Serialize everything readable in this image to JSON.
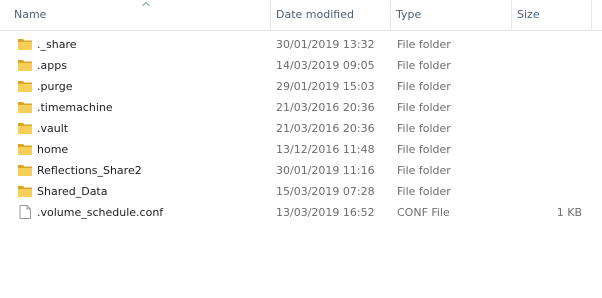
{
  "columns": {
    "name": "Name",
    "date_modified": "Date modified",
    "type": "Type",
    "size": "Size"
  },
  "sort": {
    "column": "name",
    "direction": "ascending"
  },
  "files": [
    {
      "name": "._share",
      "date": "30/01/2019 13:32",
      "type": "File folder",
      "size": "",
      "icon": "folder-icon"
    },
    {
      "name": ".apps",
      "date": "14/03/2019 09:05",
      "type": "File folder",
      "size": "",
      "icon": "folder-icon"
    },
    {
      "name": ".purge",
      "date": "29/01/2019 15:03",
      "type": "File folder",
      "size": "",
      "icon": "folder-icon"
    },
    {
      "name": ".timemachine",
      "date": "21/03/2016 20:36",
      "type": "File folder",
      "size": "",
      "icon": "folder-icon"
    },
    {
      "name": ".vault",
      "date": "21/03/2016 20:36",
      "type": "File folder",
      "size": "",
      "icon": "folder-icon"
    },
    {
      "name": "home",
      "date": "13/12/2016 11:48",
      "type": "File folder",
      "size": "",
      "icon": "folder-icon"
    },
    {
      "name": "Reflections_Share2",
      "date": "30/01/2019 11:16",
      "type": "File folder",
      "size": "",
      "icon": "folder-icon"
    },
    {
      "name": "Shared_Data",
      "date": "15/03/2019 07:28",
      "type": "File folder",
      "size": "",
      "icon": "folder-icon"
    },
    {
      "name": ".volume_schedule.conf",
      "date": "13/03/2019 16:52",
      "type": "CONF File",
      "size": "1 KB",
      "icon": "document-icon"
    }
  ],
  "colors": {
    "header_text": "#4c607a",
    "folder_yellow": "#f2c94c",
    "folder_dark": "#d9a627",
    "secondary_text": "#6d6d6d"
  }
}
